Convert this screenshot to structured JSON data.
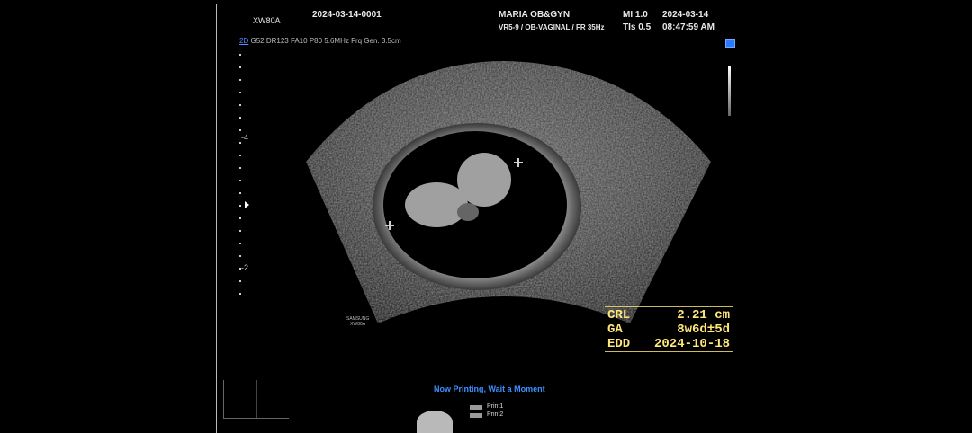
{
  "header": {
    "model": "XW80A",
    "study_id": "2024-03-14-0001",
    "institution": "MARIA OB&GYN",
    "probe_preset": "VR5-9 / OB-VAGINAL / FR 35Hz",
    "mi": "MI 1.0",
    "tis": "TIs 0.5",
    "date": "2024-03-14",
    "time": "08:47:59 AM"
  },
  "image_params": {
    "mode": "2D",
    "settings": "G52 DR123 FA10 P80 5.6MHz Frq Gen. 3.5cm"
  },
  "depth_scale": {
    "labels": [
      "-4",
      "-2"
    ]
  },
  "watermark": {
    "brand": "SAMSUNG",
    "model": "XW80A"
  },
  "measurements": [
    {
      "label": "CRL",
      "value": "2.21 cm"
    },
    {
      "label": "GA",
      "value": "8w6d±5d"
    },
    {
      "label": "EDD",
      "value": "2024-10-18"
    }
  ],
  "print_status": "Now Printing, Wait a Moment",
  "print_items": [
    "Print1",
    "Print2"
  ],
  "colors": {
    "measurement": "#ffe77a",
    "accent": "#3b91ff"
  }
}
